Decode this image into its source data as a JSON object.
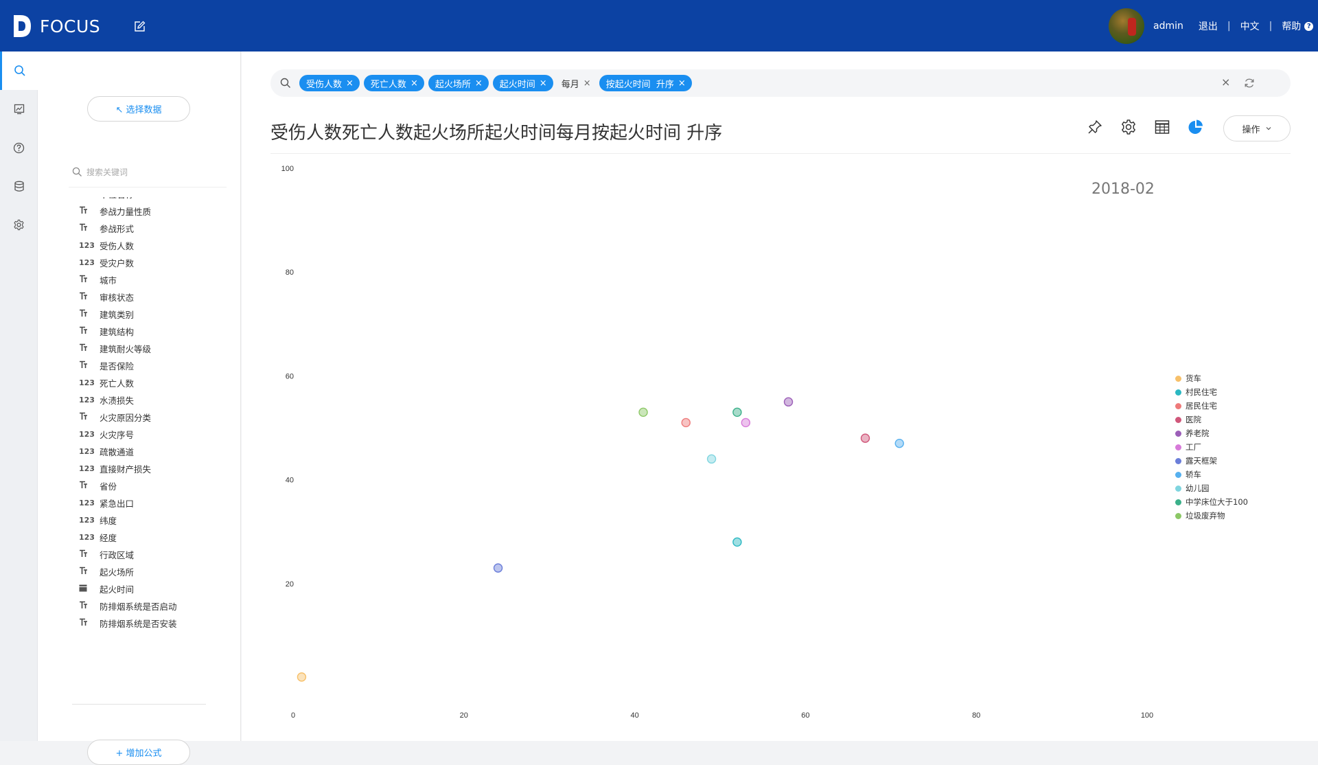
{
  "header": {
    "brand": "FOCUS",
    "user": "admin",
    "logout": "退出",
    "language": "中文",
    "help": "帮助",
    "help_icon_glyph": "?",
    "brand_color": "#0c42a3"
  },
  "rail": {
    "items": [
      {
        "icon": "search-icon",
        "active": true
      },
      {
        "icon": "chart-board-icon",
        "active": false
      },
      {
        "icon": "help-icon",
        "active": false
      },
      {
        "icon": "database-icon",
        "active": false
      },
      {
        "icon": "gear-icon",
        "active": false
      }
    ]
  },
  "fieldpanel": {
    "select_data": "↖ 选择数据",
    "search_placeholder": "搜索关键词",
    "add_formula": "+ 增加公式",
    "fields": [
      {
        "type": "T",
        "name": "单位名称"
      },
      {
        "type": "T",
        "name": "参战力量性质"
      },
      {
        "type": "T",
        "name": "参战形式"
      },
      {
        "type": "123",
        "name": "受伤人数"
      },
      {
        "type": "123",
        "name": "受灾户数"
      },
      {
        "type": "T",
        "name": "城市"
      },
      {
        "type": "T",
        "name": "审核状态"
      },
      {
        "type": "T",
        "name": "建筑类别"
      },
      {
        "type": "T",
        "name": "建筑结构"
      },
      {
        "type": "T",
        "name": "建筑耐火等级"
      },
      {
        "type": "T",
        "name": "是否保险"
      },
      {
        "type": "123",
        "name": "死亡人数"
      },
      {
        "type": "123",
        "name": "水渍损失"
      },
      {
        "type": "T",
        "name": "火灾原因分类"
      },
      {
        "type": "123",
        "name": "火灾序号"
      },
      {
        "type": "123",
        "name": "疏散通道"
      },
      {
        "type": "123",
        "name": "直接财产损失"
      },
      {
        "type": "T",
        "name": "省份"
      },
      {
        "type": "123",
        "name": "紧急出口"
      },
      {
        "type": "123",
        "name": "纬度"
      },
      {
        "type": "123",
        "name": "经度"
      },
      {
        "type": "T",
        "name": "行政区域"
      },
      {
        "type": "T",
        "name": "起火场所"
      },
      {
        "type": "date",
        "name": "起火时间"
      },
      {
        "type": "T",
        "name": "防排烟系统是否启动"
      },
      {
        "type": "T",
        "name": "防排烟系统是否安装"
      }
    ]
  },
  "search": {
    "tags": [
      {
        "label": "受伤人数",
        "style": "blue"
      },
      {
        "label": "死亡人数",
        "style": "blue"
      },
      {
        "label": "起火场所",
        "style": "blue"
      },
      {
        "label": "起火时间",
        "style": "blue"
      },
      {
        "label": "每月",
        "style": "plain"
      },
      {
        "label": "按起火时间  升序",
        "style": "blue"
      }
    ],
    "remove_glyph": "×",
    "clear_glyph": "×"
  },
  "main": {
    "title": "受伤人数死亡人数起火场所起火时间每月按起火时间 升序",
    "operation_button": "操作",
    "accent_color": "#1a8ef0"
  },
  "chart_data": {
    "type": "scatter",
    "period_label": "2018-02",
    "xlim": [
      0,
      100
    ],
    "ylim": [
      0,
      100
    ],
    "x_ticks": [
      0,
      20,
      40,
      60,
      80,
      100
    ],
    "y_ticks": [
      20,
      40,
      60,
      80,
      100
    ],
    "grid": false,
    "legend_position": "right",
    "series": [
      {
        "name": "货车",
        "color": "#f7c06a",
        "points": [
          [
            1,
            2
          ]
        ]
      },
      {
        "name": "村民住宅",
        "color": "#2bb8c2",
        "points": [
          [
            52,
            28
          ]
        ]
      },
      {
        "name": "居民住宅",
        "color": "#ee7a7a",
        "points": [
          [
            46,
            51
          ]
        ]
      },
      {
        "name": "医院",
        "color": "#d0577a",
        "points": [
          [
            67,
            48
          ]
        ]
      },
      {
        "name": "养老院",
        "color": "#9c5fb8",
        "points": [
          [
            58,
            55
          ]
        ]
      },
      {
        "name": "工厂",
        "color": "#d77ad9",
        "points": [
          [
            53,
            51
          ]
        ]
      },
      {
        "name": "露天框架",
        "color": "#6b7ed9",
        "points": [
          [
            24,
            23
          ]
        ]
      },
      {
        "name": "轿车",
        "color": "#56b0ef",
        "points": [
          [
            71,
            47
          ]
        ]
      },
      {
        "name": "幼儿园",
        "color": "#7fd5df",
        "points": [
          [
            49,
            44
          ]
        ]
      },
      {
        "name": "中学床位大于100",
        "color": "#3bb08a",
        "points": [
          [
            52,
            53
          ]
        ]
      },
      {
        "name": "垃圾废弃物",
        "color": "#8cc866",
        "points": [
          [
            41,
            53
          ]
        ]
      }
    ]
  }
}
